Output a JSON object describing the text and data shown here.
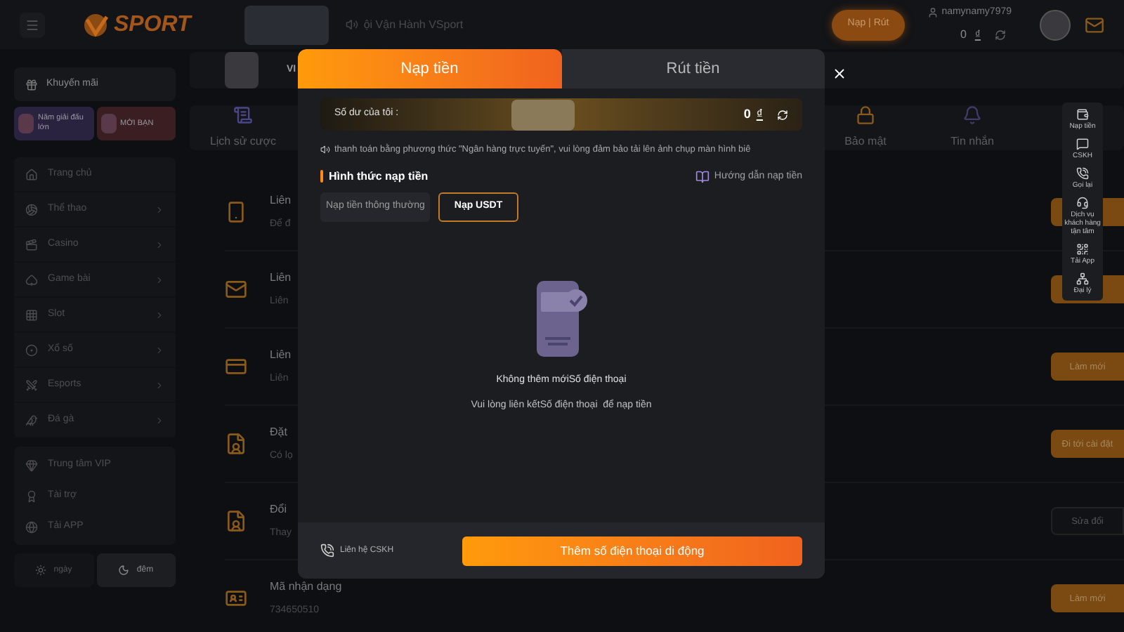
{
  "header": {
    "logo": "SPORT",
    "announcement": "ội Vận Hành VSport",
    "deposit_button": "Nạp | Rút",
    "username": "namynamy7979",
    "balance": "0",
    "currency": "₫"
  },
  "sidebar": {
    "promo": "Khuyến mãi",
    "promo_cards": [
      {
        "label": "Năm giải đấu lớn",
        "color": "#2a2340"
      },
      {
        "label": "MỜI BẠN",
        "color": "#3a1e22"
      }
    ],
    "menu": [
      {
        "label": "Trang chủ",
        "kind": "home",
        "expandable": false
      },
      {
        "label": "Thể thao",
        "kind": "sport",
        "expandable": true
      },
      {
        "label": "Casino",
        "kind": "casino",
        "expandable": true
      },
      {
        "label": "Game bài",
        "kind": "cards",
        "expandable": true
      },
      {
        "label": "Slot",
        "kind": "slot",
        "expandable": true
      },
      {
        "label": "Xổ số",
        "kind": "lottery",
        "expandable": true
      },
      {
        "label": "Esports",
        "kind": "esports",
        "expandable": true
      },
      {
        "label": "Đá gà",
        "kind": "cock",
        "expandable": true
      }
    ],
    "extras": [
      {
        "label": "Trung tâm VIP",
        "kind": "vip"
      },
      {
        "label": "Tài trợ",
        "kind": "sponsor"
      },
      {
        "label": "Tải APP",
        "kind": "app"
      }
    ],
    "theme": [
      {
        "label": "ngày",
        "kind": "day",
        "selected": false
      },
      {
        "label": "đêm",
        "kind": "night",
        "selected": true
      }
    ]
  },
  "main": {
    "profile_title": "VI",
    "nav": [
      {
        "label": "Lịch sử cược",
        "kind": "history"
      },
      {
        "label": "Bảo mật",
        "kind": "lock"
      },
      {
        "label": "Tin nhắn",
        "kind": "bell"
      }
    ],
    "rows": [
      {
        "title": "Liên",
        "subtitle": "Để đ",
        "kind": "phone",
        "action": {
          "kind": "primary"
        }
      },
      {
        "title": "Liên",
        "subtitle": "Liên",
        "kind": "mail",
        "action": {
          "kind": "primary"
        }
      },
      {
        "title": "Liên",
        "subtitle": "Liên",
        "kind": "card",
        "action": {
          "kind": "primary",
          "label": "Làm mới"
        }
      },
      {
        "title": "Đặt",
        "subtitle": "Có lọ",
        "kind": "doc",
        "action": {
          "kind": "primary",
          "label": "Đi tới cài đặt"
        }
      },
      {
        "title": "Đổi",
        "subtitle": "Thay",
        "kind": "doc",
        "action": {
          "kind": "secondary",
          "label": "Sửa đổi"
        }
      },
      {
        "title": "Mã nhận dạng",
        "subtitle": "734650510",
        "kind": "id",
        "action": {
          "kind": "primary",
          "label": "Làm mới"
        }
      }
    ]
  },
  "modal": {
    "tabs": [
      {
        "label": "Nạp tiền",
        "selected": true
      },
      {
        "label": "Rút tiền",
        "selected": false
      }
    ],
    "balance_label": "Số dư của tôi :",
    "balance": "0",
    "currency": "₫",
    "notice": "thanh toán bằng phương thức \"Ngân hàng trực tuyến\", vui lòng đảm bảo tải lên ảnh chụp màn hình biê",
    "section_title": "Hình thức nạp tiền",
    "guide": "Hướng dẫn nạp tiền",
    "methods": [
      {
        "label": "Nạp tiền thông thường",
        "selected": false
      },
      {
        "label": "Nạp USDT",
        "selected": true
      }
    ],
    "empty_title": "Không thêm mớiSố điện thoại",
    "empty_hint": "Vui lòng liên kếtSố điện thoại  để nạp tiền",
    "contact": "Liên hệ CSKH",
    "submit": "Thêm số điện thoại di động"
  },
  "toolbar": [
    {
      "label": "Nạp tiền",
      "kind": "wallet"
    },
    {
      "label": "CSKH",
      "kind": "chat"
    },
    {
      "label": "Gọi lại",
      "kind": "phone"
    },
    {
      "label": "Dịch vụ khách hàng tận tâm",
      "kind": "support"
    },
    {
      "label": "Tải App",
      "kind": "qr"
    },
    {
      "label": "Đại lý",
      "kind": "agent"
    }
  ]
}
